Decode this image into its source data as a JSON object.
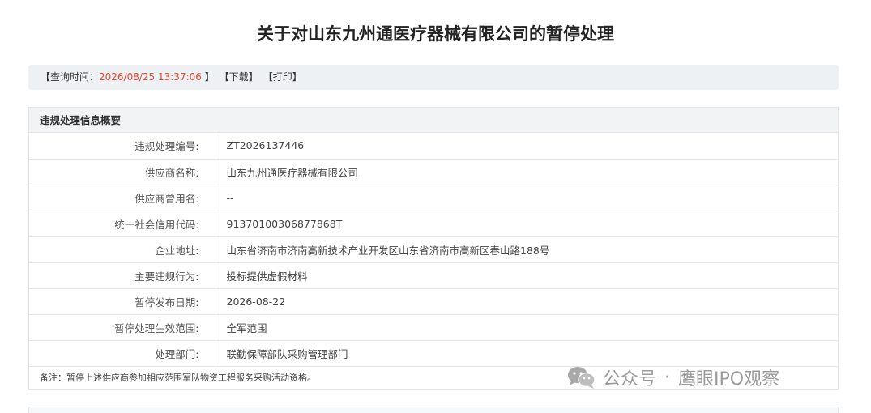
{
  "page": {
    "title": "关于对山东九州通医疗器械有限公司的暂停处理"
  },
  "query_bar": {
    "time_label": "【查询时间：",
    "time_value": "2026/08/25 13:37:06",
    "time_close": " 】",
    "download": "【下载】",
    "print": "【打印】"
  },
  "panel": {
    "header": "违规处理信息概要",
    "rows": [
      {
        "label": "违规处理编号:",
        "value": "ZT2026137446"
      },
      {
        "label": "供应商名称:",
        "value": "山东九州通医疗器械有限公司"
      },
      {
        "label": "供应商曾用名:",
        "value": "--"
      },
      {
        "label": "统一社会信用代码:",
        "value": "91370100306877868T"
      },
      {
        "label": "企业地址:",
        "value": "山东省济南市济南高新技术产业开发区山东省济南市高新区春山路188号"
      },
      {
        "label": "主要违规行为:",
        "value": "投标提供虚假材料"
      },
      {
        "label": "暂停发布日期:",
        "value": "2026-08-22"
      },
      {
        "label": "暂停处理生效范围:",
        "value": "全军范围"
      },
      {
        "label": "处理部门:",
        "value": "联勤保障部队采购管理部门"
      }
    ],
    "remark": "备注：暂停上述供应商参加相应范围军队物资工程服务采购活动资格。"
  },
  "watermark": {
    "text1": "公众号",
    "dot": "·",
    "text2": "鹰眼IPO观察",
    "icon": "wechat-icon"
  }
}
